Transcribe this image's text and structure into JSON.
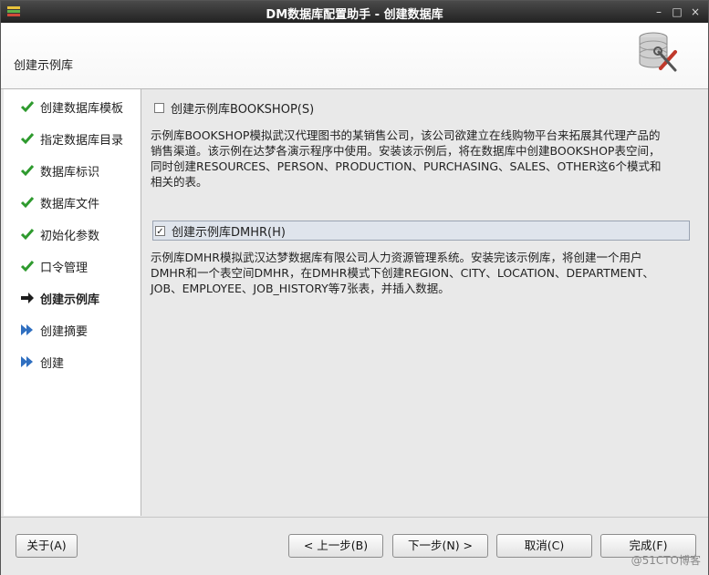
{
  "window": {
    "title": "DM数据库配置助手 - 创建数据库",
    "controls": [
      "–",
      "□",
      "×"
    ]
  },
  "header": {
    "heading": "创建示例库"
  },
  "sidebar": {
    "steps": [
      {
        "label": "创建数据库模板",
        "status": "done"
      },
      {
        "label": "指定数据库目录",
        "status": "done"
      },
      {
        "label": "数据库标识",
        "status": "done"
      },
      {
        "label": "数据库文件",
        "status": "done"
      },
      {
        "label": "初始化参数",
        "status": "done"
      },
      {
        "label": "口令管理",
        "status": "done"
      },
      {
        "label": "创建示例库",
        "status": "current"
      },
      {
        "label": "创建摘要",
        "status": "pending"
      },
      {
        "label": "创建",
        "status": "pending"
      }
    ]
  },
  "main": {
    "bookshop": {
      "checkbox_label": "创建示例库BOOKSHOP(S)",
      "checked": false,
      "description_lines": [
        "示例库BOOKSHOP模拟武汉代理图书的某销售公司，该公司欲建立在线购物平台来拓展其代理产品的",
        "销售渠道。该示例在达梦各演示程序中使用。安装该示例后，将在数据库中创建BOOKSHOP表空间，",
        "同时创建RESOURCES、PERSON、PRODUCTION、PURCHASING、SALES、OTHER这6个模式和",
        "相关的表。"
      ]
    },
    "dmhr": {
      "checkbox_label": "创建示例库DMHR(H)",
      "checked": true,
      "description_lines": [
        "示例库DMHR模拟武汉达梦数据库有限公司人力资源管理系统。安装完该示例库，将创建一个用户",
        "DMHR和一个表空间DMHR，在DMHR模式下创建REGION、CITY、LOCATION、DEPARTMENT、",
        "JOB、EMPLOYEE、JOB_HISTORY等7张表，并插入数据。"
      ]
    }
  },
  "footer": {
    "about": "关于(A)",
    "back": "< 上一步(B)",
    "next": "下一步(N) >",
    "cancel": "取消(C)",
    "finish": "完成(F)"
  },
  "watermark": "@51CTO博客",
  "colors": {
    "check_green": "#2e9a2e",
    "arrow_blue": "#2f6fc0",
    "current_arrow": "#1d1d1d"
  }
}
